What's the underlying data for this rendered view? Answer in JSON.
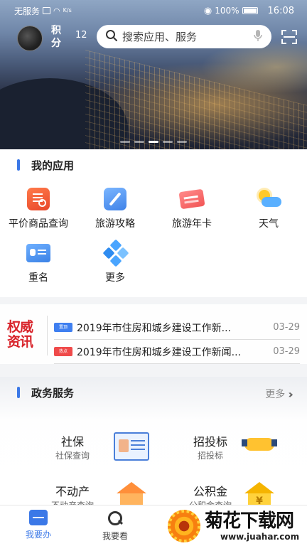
{
  "status": {
    "carrier": "无服务",
    "speed_unit": "K/s",
    "battery": "100%",
    "time": "16:08"
  },
  "header": {
    "points_label": "积分",
    "points_value": "12",
    "search_placeholder": "搜索应用、服务"
  },
  "banner": {
    "page_count": 5,
    "active_page": 3
  },
  "my_apps": {
    "title": "我的应用",
    "items": [
      {
        "label": "平价商品查询",
        "icon": "price-query-icon"
      },
      {
        "label": "旅游攻略",
        "icon": "travel-guide-icon"
      },
      {
        "label": "旅游年卡",
        "icon": "travel-card-icon"
      },
      {
        "label": "天气",
        "icon": "weather-icon"
      },
      {
        "label": "重名",
        "icon": "duplicate-name-icon"
      },
      {
        "label": "更多",
        "icon": "more-icon"
      }
    ]
  },
  "news": {
    "logo_line1": "权威",
    "logo_line2": "资讯",
    "items": [
      {
        "tag": "置顶",
        "title": "2019年市住房和城乡建设工作新...",
        "date": "03-29"
      },
      {
        "tag": "热点",
        "title": "2019年市住房和城乡建设工作新闻...",
        "date": "03-29"
      }
    ]
  },
  "gov_services": {
    "title": "政务服务",
    "more_label": "更多",
    "items": [
      {
        "name": "社保",
        "sub": "社保查询",
        "icon": "social-security-card-icon"
      },
      {
        "name": "招投标",
        "sub": "招投标",
        "icon": "handshake-icon"
      },
      {
        "name": "不动产",
        "sub": "不动产查询",
        "icon": "house-icon"
      },
      {
        "name": "公积金",
        "sub": "公积金查询",
        "icon": "housing-fund-icon"
      }
    ]
  },
  "tabbar": {
    "tabs": [
      {
        "label": "我要办",
        "active": true
      },
      {
        "label": "我要看",
        "active": false
      }
    ]
  },
  "watermark": {
    "name": "菊花下载网",
    "url": "www.juahar.com"
  },
  "colors": {
    "accent": "#3b78e7",
    "news_logo": "#d8232a"
  }
}
